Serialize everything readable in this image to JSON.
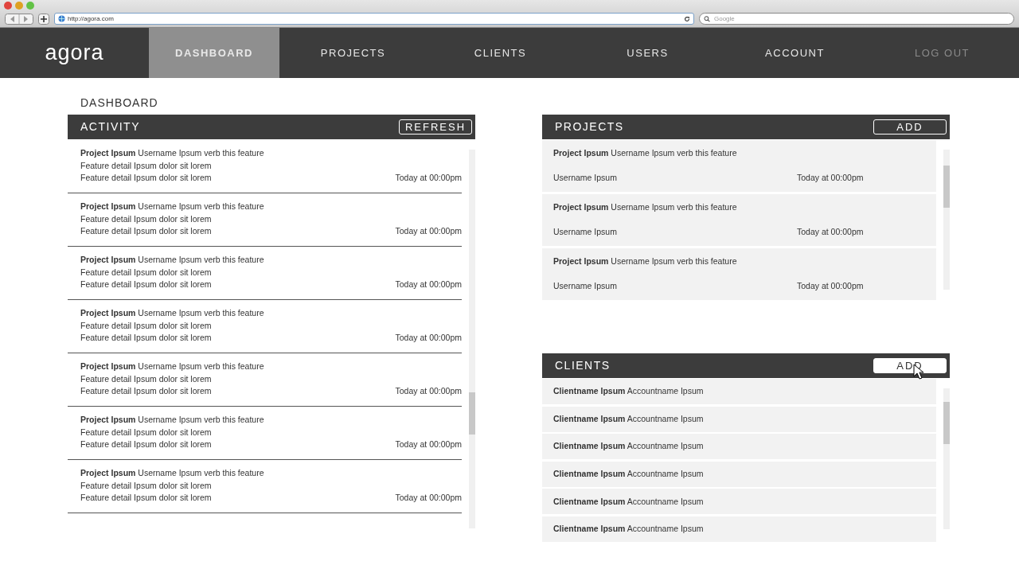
{
  "browser": {
    "url": "http://agora.com",
    "search_placeholder": "Google"
  },
  "nav": {
    "logo": "agora",
    "items": [
      {
        "label": "DASHBOARD",
        "selected": true,
        "dimmed": false
      },
      {
        "label": "PROJECTS",
        "selected": false,
        "dimmed": false
      },
      {
        "label": "CLIENTS",
        "selected": false,
        "dimmed": false
      },
      {
        "label": "USERS",
        "selected": false,
        "dimmed": false
      },
      {
        "label": "ACCOUNT",
        "selected": false,
        "dimmed": false
      },
      {
        "label": "LOG OUT",
        "selected": false,
        "dimmed": true
      }
    ]
  },
  "page_title": "DASHBOARD",
  "activity": {
    "title": "ACTIVITY",
    "button": {
      "label": "REFRESH",
      "hovered": false
    },
    "items": [
      {
        "headline": "**Project Ipsum** Username Ipsum verb this feature",
        "lines": [
          "Feature detail Ipsum dolor sit lorem",
          "Feature detail Ipsum dolor sit lorem"
        ],
        "time": "Today at 00:00pm"
      },
      {
        "headline": "**Project Ipsum** Username Ipsum verb this feature",
        "lines": [
          "Feature detail Ipsum dolor sit lorem",
          "Feature detail Ipsum dolor sit lorem"
        ],
        "time": "Today at 00:00pm"
      },
      {
        "headline": "**Project Ipsum** Username Ipsum verb this feature",
        "lines": [
          "Feature detail Ipsum dolor sit lorem",
          "Feature detail Ipsum dolor sit lorem"
        ],
        "time": "Today at 00:00pm"
      },
      {
        "headline": "**Project Ipsum** Username Ipsum verb this feature",
        "lines": [
          "Feature detail Ipsum dolor sit lorem",
          "Feature detail Ipsum dolor sit lorem"
        ],
        "time": "Today at 00:00pm"
      },
      {
        "headline": "**Project Ipsum** Username Ipsum verb this feature",
        "lines": [
          "Feature detail Ipsum dolor sit lorem",
          "Feature detail Ipsum dolor sit lorem"
        ],
        "time": "Today at 00:00pm"
      },
      {
        "headline": "**Project Ipsum** Username Ipsum verb this feature",
        "lines": [
          "Feature detail Ipsum dolor sit lorem",
          "Feature detail Ipsum dolor sit lorem"
        ],
        "time": "Today at 00:00pm"
      },
      {
        "headline": "**Project Ipsum** Username Ipsum verb this feature",
        "lines": [
          "Feature detail Ipsum dolor sit lorem",
          "Feature detail Ipsum dolor sit lorem"
        ],
        "time": "Today at 00:00pm"
      }
    ]
  },
  "projects": {
    "title": "PROJECTS",
    "button": {
      "label": "ADD",
      "hovered": false
    },
    "items": [
      {
        "headline": "**Project Ipsum** Username Ipsum verb this feature",
        "user": "Username Ipsum",
        "time": "Today at 00:00pm"
      },
      {
        "headline": "**Project Ipsum** Username Ipsum verb this feature",
        "user": "Username Ipsum",
        "time": "Today at 00:00pm"
      },
      {
        "headline": "**Project Ipsum** Username Ipsum verb this feature",
        "user": "Username Ipsum",
        "time": "Today at 00:00pm"
      }
    ]
  },
  "clients": {
    "title": "CLIENTS",
    "button": {
      "label": "ADD",
      "hovered": true
    },
    "items": [
      {
        "text": "**Clientname Ipsum** Accountname Ipsum"
      },
      {
        "text": "**Clientname Ipsum** Accountname Ipsum"
      },
      {
        "text": "**Clientname Ipsum** Accountname Ipsum"
      },
      {
        "text": "**Clientname Ipsum** Accountname Ipsum"
      },
      {
        "text": "**Clientname Ipsum** Accountname Ipsum"
      },
      {
        "text": "**Clientname Ipsum** Accountname Ipsum"
      }
    ]
  }
}
